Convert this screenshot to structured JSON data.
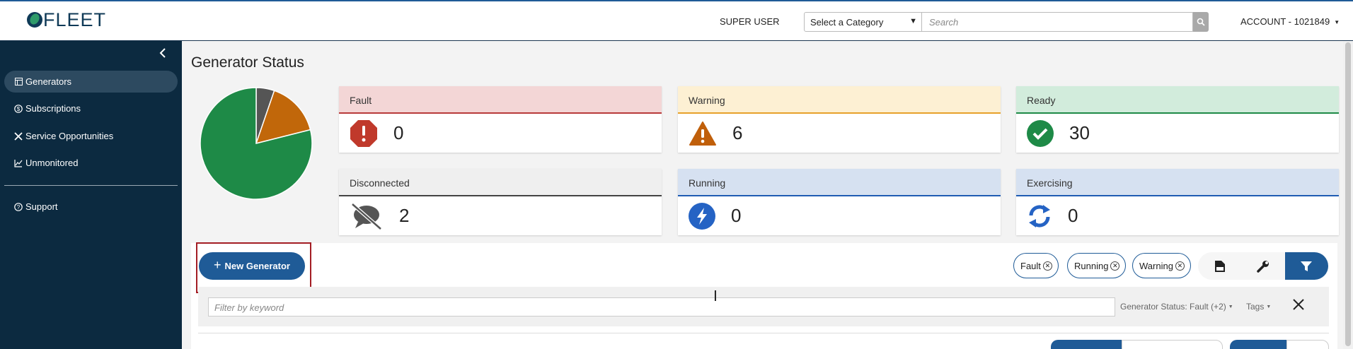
{
  "brand": {
    "logo_text": "FLEET"
  },
  "header": {
    "user_role": "SUPER USER",
    "category_select": "Select a Category",
    "search_placeholder": "Search",
    "account": "ACCOUNT - 1021849"
  },
  "sidebar": {
    "items": [
      {
        "label": "Generators",
        "icon": "list-icon",
        "active": true
      },
      {
        "label": "Subscriptions",
        "icon": "dollar-icon",
        "active": false
      },
      {
        "label": "Service Opportunities",
        "icon": "tools-icon",
        "active": false
      },
      {
        "label": "Unmonitored",
        "icon": "chart-line-icon",
        "active": false
      },
      {
        "label": "Support",
        "icon": "question-icon",
        "active": false
      }
    ]
  },
  "page": {
    "title": "Generator Status"
  },
  "status_cards": [
    {
      "label": "Fault",
      "value": "0",
      "icon": "exclamation-octagon-icon",
      "color": "#c0392b"
    },
    {
      "label": "Warning",
      "value": "6",
      "icon": "warning-triangle-icon",
      "color": "#c05f0a"
    },
    {
      "label": "Ready",
      "value": "30",
      "icon": "check-circle-icon",
      "color": "#1e8a47"
    },
    {
      "label": "Disconnected",
      "value": "2",
      "icon": "comment-slash-icon",
      "color": "#555555"
    },
    {
      "label": "Running",
      "value": "0",
      "icon": "bolt-circle-icon",
      "color": "#2563c4"
    },
    {
      "label": "Exercising",
      "value": "0",
      "icon": "sync-icon",
      "color": "#2563c4"
    }
  ],
  "pie": {
    "slices": [
      {
        "name": "Disconnected",
        "value": 2,
        "color": "#555555"
      },
      {
        "name": "Warning",
        "value": 6,
        "color": "#c1670a"
      },
      {
        "name": "Ready",
        "value": 30,
        "color": "#1e8a47"
      }
    ]
  },
  "actions": {
    "new_generator": "New Generator"
  },
  "filter_chips": [
    "Fault",
    "Running",
    "Warning"
  ],
  "view_buttons": [
    {
      "icon": "csv-file-icon",
      "active": false
    },
    {
      "icon": "wrench-icon",
      "active": false
    },
    {
      "icon": "filter-icon",
      "active": true
    }
  ],
  "filters": {
    "keyword_placeholder": "Filter by keyword",
    "generator_status": "Generator Status: Fault (+2)",
    "tags": "Tags"
  },
  "colors": {
    "primary": "#1f5b97",
    "sidebar_bg": "#0c2a40"
  }
}
